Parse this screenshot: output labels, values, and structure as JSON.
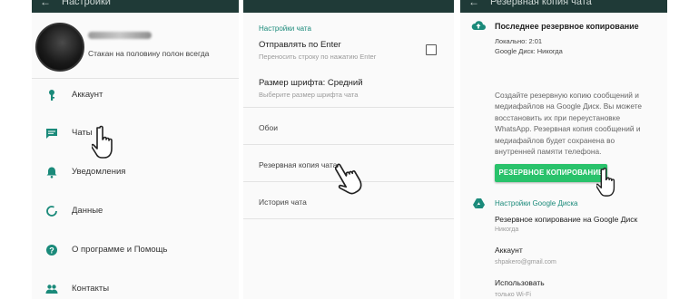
{
  "panel1": {
    "title": "Настройки",
    "status": "Стакан на половину полон всегда",
    "menu": [
      {
        "label": "Аккаунт",
        "icon": "key-icon"
      },
      {
        "label": "Чаты",
        "icon": "chat-icon"
      },
      {
        "label": "Уведомления",
        "icon": "bell-icon"
      },
      {
        "label": "Данные",
        "icon": "data-usage-icon"
      },
      {
        "label": "О программе и Помощь",
        "icon": "help-icon"
      },
      {
        "label": "Контакты",
        "icon": "contacts-icon"
      }
    ]
  },
  "panel2": {
    "section": "Настройки чата",
    "enter_title": "Отправлять по Enter",
    "enter_sub": "Переносить строку по нажатию Enter",
    "font_title": "Размер шрифта: Средний",
    "font_sub": "Выберите размер шрифта чата",
    "wallpaper": "Обои",
    "backup": "Резервная копия чата",
    "history": "История чата"
  },
  "panel3": {
    "title": "Резервная копия чата",
    "last_backup_title": "Последнее резервное копирование",
    "local": "Локально: 2:01",
    "gdrive": "Google Диск: Никогда",
    "description": "Создайте резервную копию сообщений и медиафайлов на Google Диск. Вы можете восстановить их при переустановке WhatsApp. Резервная копия сообщений и медиафайлов будет сохранена во внутренней памяти телефона.",
    "backup_button": "РЕЗЕРВНОЕ КОПИРОВАНИЕ",
    "gdrive_section": "Настройки Google Диска",
    "gdrive_backup_title": "Резервное копирование на Google Диск",
    "gdrive_backup_value": "Никогда",
    "account_title": "Аккаунт",
    "account_value": "shpakero@gmail.com",
    "use_title": "Использовать",
    "use_value": "только Wi-Fi"
  },
  "colors": {
    "topbar": "#1f3a37",
    "accent": "#1a8a7a",
    "button": "#29c26b",
    "icon": "#1a8a7a"
  }
}
